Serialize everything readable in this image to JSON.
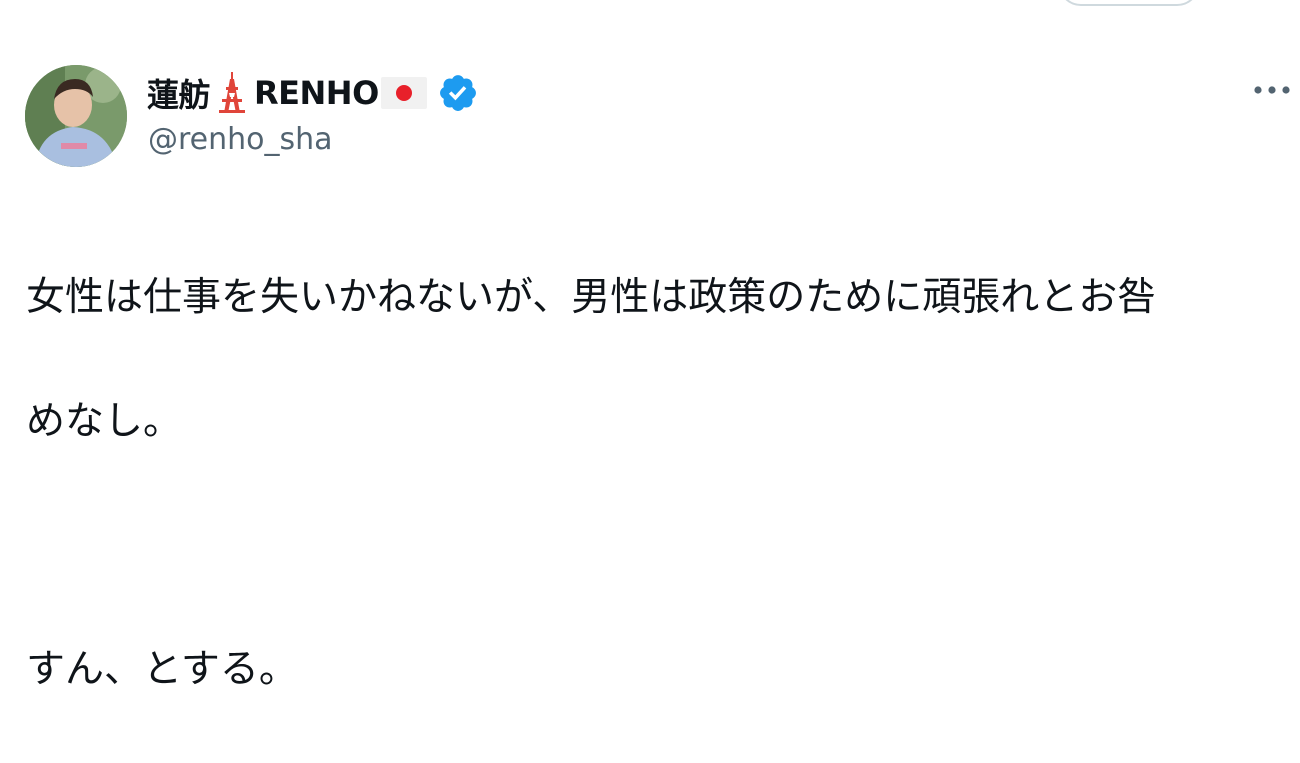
{
  "author": {
    "name_part1": "蓮舫",
    "name_part2": "RENHO",
    "handle": "@renho_sha",
    "icons": [
      "tokyo-tower-icon",
      "japan-flag-icon",
      "verified-badge-icon"
    ]
  },
  "tweet": {
    "line1": "女性は仕事を失いかねないが、男性は政策のために頑張れとお咎",
    "line2": "めなし。",
    "line3": "すん、とする。"
  },
  "colors": {
    "text": "#0f1419",
    "secondary": "#536471",
    "verified": "#1d9bf0",
    "tower": "#e0453a",
    "flag_red": "#e8202a"
  },
  "more_icon": "more-horizontal-icon"
}
